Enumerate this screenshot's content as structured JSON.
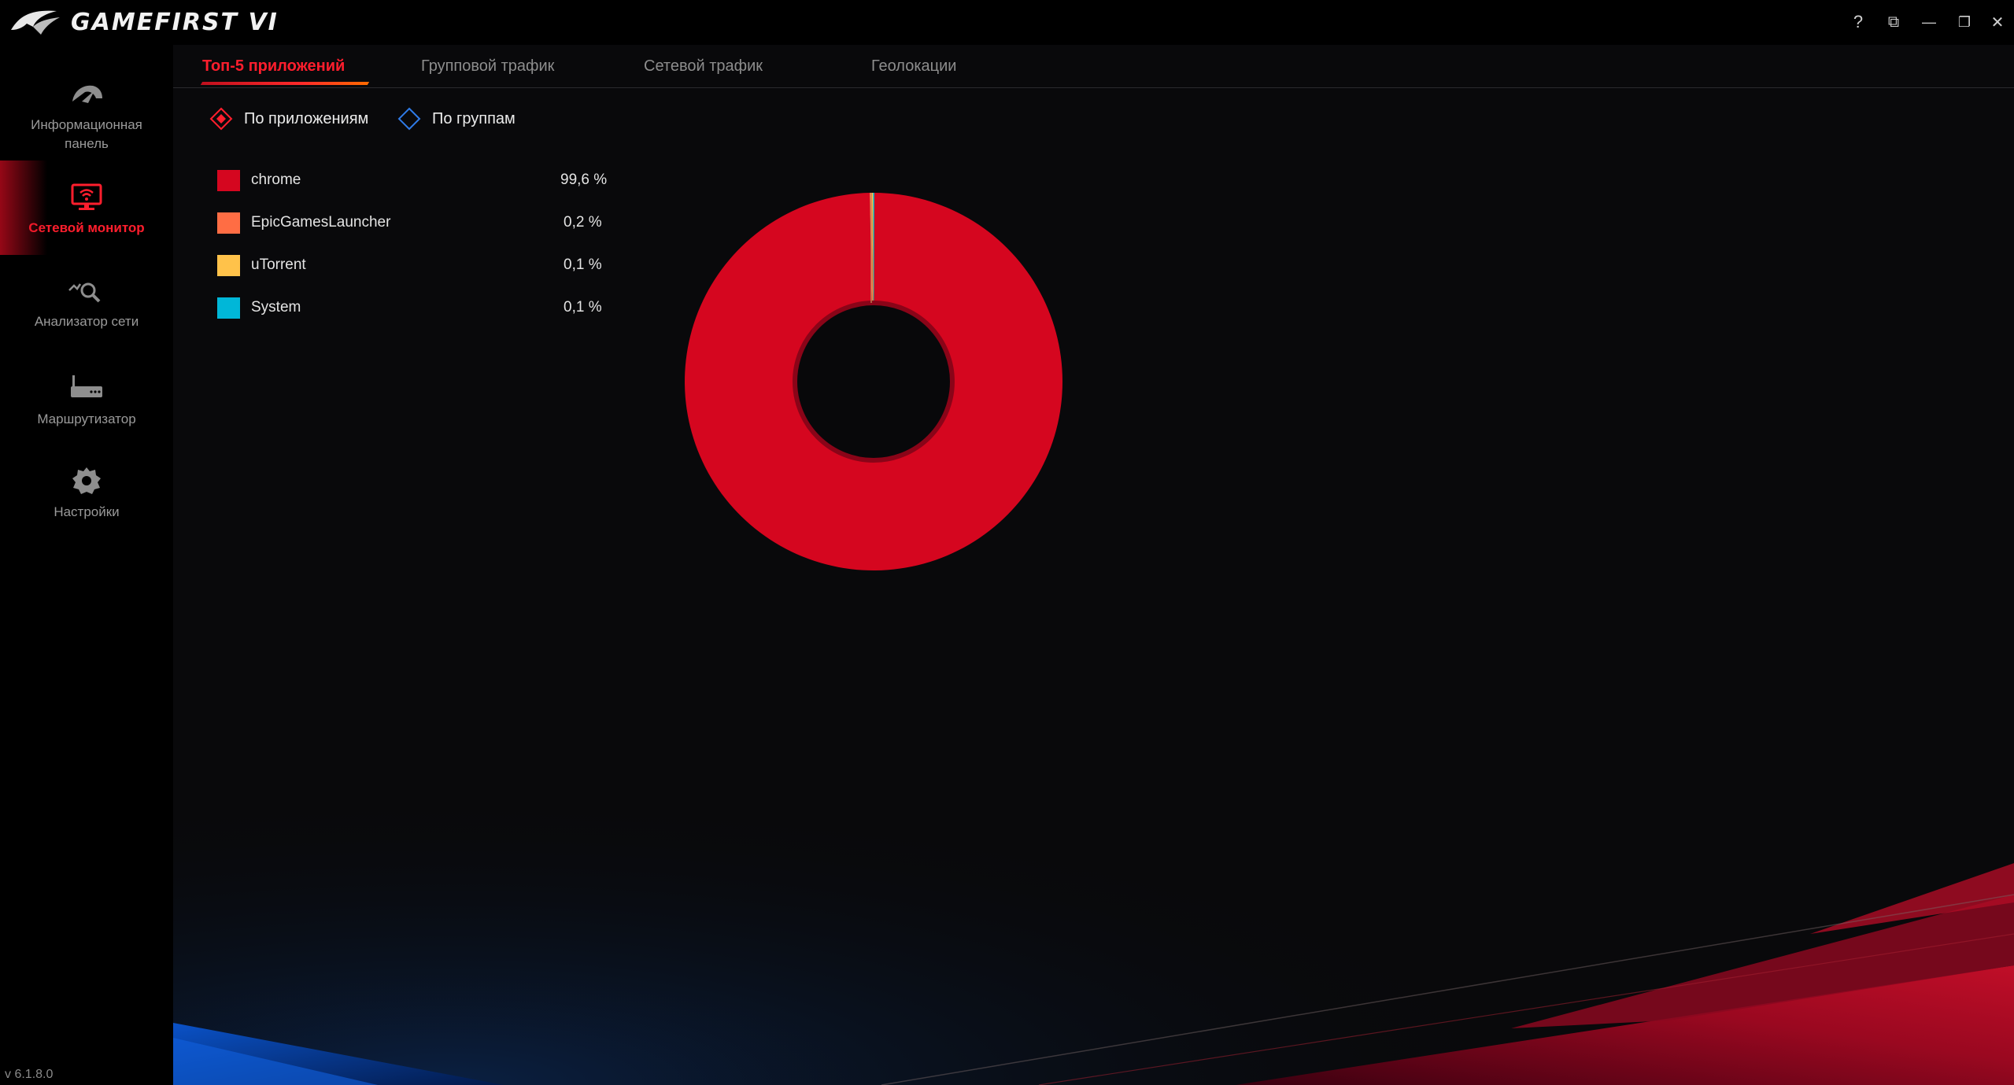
{
  "app": {
    "title": "GAMEFIRST VI",
    "version": "v 6.1.8.0"
  },
  "window_controls": [
    {
      "name": "help-button",
      "glyph": "?"
    },
    {
      "name": "display-mode-button",
      "glyph": "⧉"
    },
    {
      "name": "minimize-button",
      "glyph": "—"
    },
    {
      "name": "restore-button",
      "glyph": "❐"
    },
    {
      "name": "close-button",
      "glyph": "✕"
    }
  ],
  "sidebar": {
    "items": [
      {
        "label": "Информационная панель",
        "icon": "speedometer-icon",
        "active": false
      },
      {
        "label": "Сетевой монитор",
        "icon": "network-monitor-icon",
        "active": true
      },
      {
        "label": "Анализатор сети",
        "icon": "network-analyzer-icon",
        "active": false
      },
      {
        "label": "Маршрутизатор",
        "icon": "router-icon",
        "active": false
      },
      {
        "label": "Настройки",
        "icon": "gear-icon",
        "active": false
      }
    ]
  },
  "tabs": [
    {
      "label": "Топ-5 приложений",
      "active": true
    },
    {
      "label": "Групповой трафик",
      "active": false
    },
    {
      "label": "Сетевой трафик",
      "active": false
    },
    {
      "label": "Геолокации",
      "active": false
    }
  ],
  "view_toggle": {
    "options": [
      {
        "label": "По приложениям",
        "selected": true
      },
      {
        "label": "По группам",
        "selected": false
      }
    ]
  },
  "colors": {
    "accent": "#ff1e2d",
    "chrome": "#d5061f",
    "EpicGamesLauncher": "#ff6d44",
    "uTorrent": "#ffc24a",
    "System": "#00b7d8"
  },
  "chart_data": {
    "type": "pie",
    "title": "",
    "series": [
      {
        "name": "chrome",
        "value": 99.6,
        "label": "99,6 %",
        "color": "#d5061f"
      },
      {
        "name": "EpicGamesLauncher",
        "value": 0.2,
        "label": "0,2 %",
        "color": "#ff6d44"
      },
      {
        "name": "uTorrent",
        "value": 0.1,
        "label": "0,1 %",
        "color": "#ffc24a"
      },
      {
        "name": "System",
        "value": 0.1,
        "label": "0,1 %",
        "color": "#00b7d8"
      }
    ],
    "legend": "left",
    "donut": true
  }
}
